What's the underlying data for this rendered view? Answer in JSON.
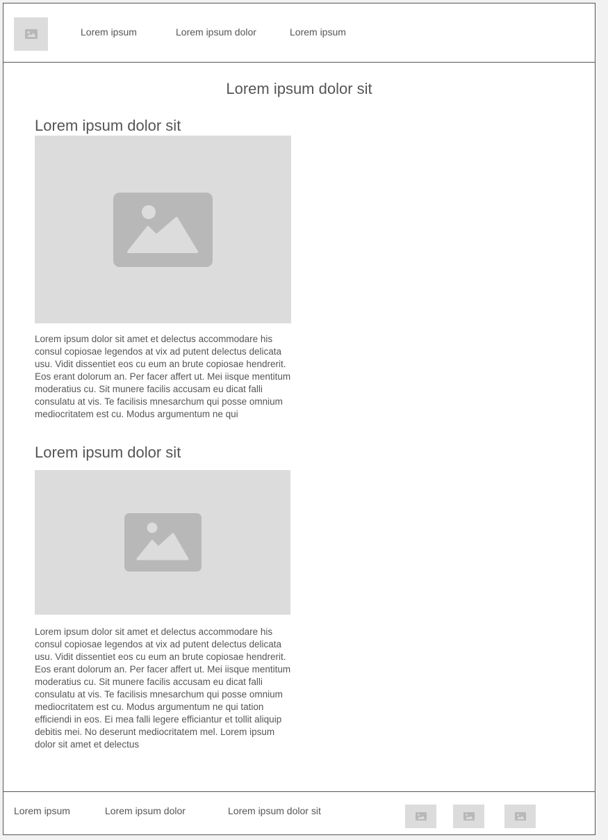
{
  "header": {
    "logo_icon": "image-placeholder-icon",
    "nav": [
      {
        "label": "Lorem ipsum"
      },
      {
        "label": "Lorem ipsum dolor"
      },
      {
        "label": "Lorem ipsum"
      }
    ]
  },
  "main": {
    "title": "Lorem ipsum dolor sit",
    "sections": [
      {
        "heading": "Lorem ipsum dolor sit",
        "image_icon": "image-placeholder-icon",
        "text": "Lorem ipsum dolor sit amet et delectus accommodare his consul copiosae legendos at vix ad putent delectus delicata usu. Vidit dissentiet eos cu eum an brute copiosae hendrerit. Eos erant dolorum an. Per facer affert ut. Mei iisque mentitum moderatius cu. Sit munere facilis accusam eu dicat falli consulatu at vis. Te facilisis mnesarchum qui posse omnium mediocritatem est cu. Modus argumentum ne qui"
      },
      {
        "heading": "Lorem ipsum dolor sit",
        "image_icon": "image-placeholder-icon",
        "text": "Lorem ipsum dolor sit amet et delectus accommodare his consul copiosae legendos at vix ad putent delectus delicata usu. Vidit dissentiet eos cu eum an brute copiosae hendrerit. Eos erant dolorum an. Per facer affert ut. Mei iisque mentitum moderatius cu. Sit munere facilis accusam eu dicat falli consulatu at vis. Te facilisis mnesarchum qui posse omnium mediocritatem est cu. Modus argumentum ne qui tation efficiendi in eos. Ei mea falli legere efficiantur et tollit aliquip debitis mei. No deserunt mediocritatem mel. Lorem ipsum dolor sit amet et delectus"
      }
    ]
  },
  "footer": {
    "links": [
      {
        "label": "Lorem ipsum"
      },
      {
        "label": "Lorem ipsum dolor"
      },
      {
        "label": "Lorem ipsum dolor sit"
      }
    ],
    "social_icons": [
      "image-placeholder-icon",
      "image-placeholder-icon",
      "image-placeholder-icon"
    ]
  },
  "colors": {
    "placeholder_bg": "#dcdcdc",
    "placeholder_icon": "#b8b8b8",
    "text": "#555555",
    "border": "#555555"
  }
}
